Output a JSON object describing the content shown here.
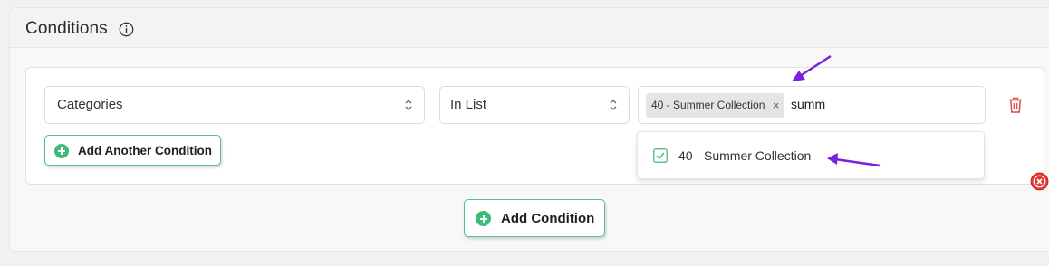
{
  "panel": {
    "title": "Conditions"
  },
  "condition_row": {
    "field_select": {
      "value": "Categories"
    },
    "operator_select": {
      "value": "In List"
    },
    "values_multiselect": {
      "selected_tags": [
        "40 - Summer Collection"
      ],
      "remove_tag_symbol": "×",
      "typed_text": "summ"
    }
  },
  "dropdown": {
    "options": [
      {
        "label": "40 - Summer Collection",
        "checked": true
      }
    ]
  },
  "buttons": {
    "add_another_condition": "Add Another Condition",
    "add_condition": "Add Condition"
  },
  "icons": {
    "info": "info-icon",
    "chevron": "up-down-chevron-icon",
    "trash": "trash-icon",
    "plus": "plus-circle-icon",
    "check": "checkbox-check-icon",
    "error": "close-circle-icon"
  },
  "colors": {
    "accent_green": "#3dbb7a",
    "button_border": "#54c08b",
    "delete_red": "#e04a4a",
    "annotation_purple": "#7b1fe0"
  }
}
